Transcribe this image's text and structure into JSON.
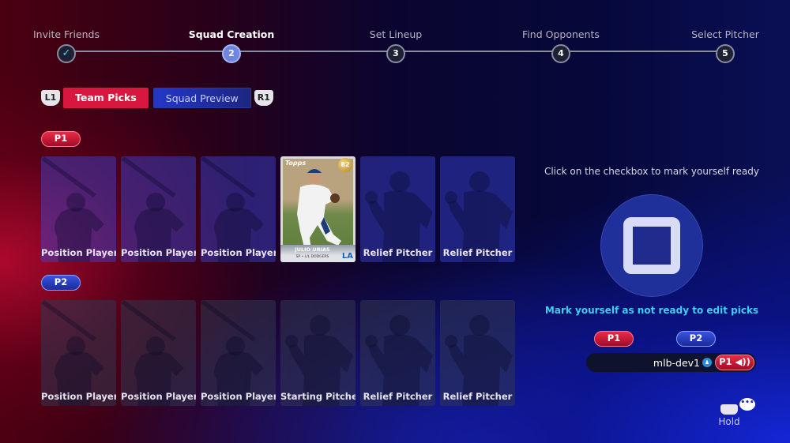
{
  "stepper": {
    "steps": [
      {
        "label": "Invite Friends",
        "marker": "✓",
        "state": "done"
      },
      {
        "label": "Squad Creation",
        "marker": "2",
        "state": "active"
      },
      {
        "label": "Set Lineup",
        "marker": "3",
        "state": "pending"
      },
      {
        "label": "Find Opponents",
        "marker": "4",
        "state": "pending"
      },
      {
        "label": "Select Pitcher",
        "marker": "5",
        "state": "pending"
      }
    ]
  },
  "tabs": {
    "left_shoulder": "L1",
    "right_shoulder": "R1",
    "team_picks": "Team Picks",
    "squad_preview": "Squad Preview",
    "active": "Team Picks"
  },
  "squads": {
    "p1": {
      "badge": "P1",
      "cards": [
        {
          "label": "Position Player",
          "type": "batter"
        },
        {
          "label": "Position Player",
          "type": "batter"
        },
        {
          "label": "Position Player",
          "type": "batter"
        },
        {
          "label": "",
          "type": "player",
          "player": {
            "brand": "Topps",
            "rating": "82",
            "name": "JULIO URIAS",
            "team_line": "SP • L/L DODGERS",
            "team_logo": "LA"
          }
        },
        {
          "label": "Relief Pitcher",
          "type": "pitcher"
        },
        {
          "label": "Relief Pitcher",
          "type": "pitcher"
        }
      ]
    },
    "p2": {
      "badge": "P2",
      "cards": [
        {
          "label": "Position Player",
          "type": "batter"
        },
        {
          "label": "Position Player",
          "type": "batter"
        },
        {
          "label": "Position Player",
          "type": "batter"
        },
        {
          "label": "Starting Pitcher",
          "type": "pitcher"
        },
        {
          "label": "Relief Pitcher",
          "type": "pitcher"
        },
        {
          "label": "Relief Pitcher",
          "type": "pitcher"
        }
      ]
    }
  },
  "ready_panel": {
    "hint": "Click on the checkbox to mark yourself ready",
    "status": "Mark yourself as not ready to edit picks",
    "p1_label": "P1",
    "p2_label": "P2",
    "user": {
      "name": "mlb-dev1",
      "platform_icon": "playstation-icon",
      "slot": "P1 ◀))"
    }
  },
  "chat": {
    "hold_label": "Hold",
    "chat_glyph": "•••"
  }
}
